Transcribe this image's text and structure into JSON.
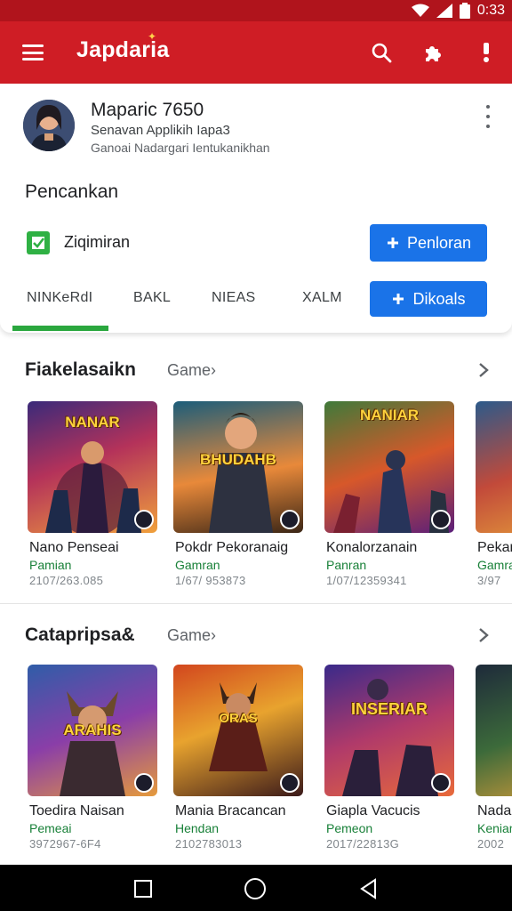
{
  "status_bar": {
    "time": "0:33",
    "icons": [
      "wifi-icon",
      "signal-icon",
      "battery-icon"
    ]
  },
  "app_bar": {
    "title": "Japdaria",
    "icons": [
      "menu-icon",
      "search-icon",
      "puzzle-icon",
      "notification-icon"
    ]
  },
  "profile": {
    "name": "Maparic 7650",
    "line1": "Senavan Applikih Iapa3",
    "line2": "Ganoai Nadargari Ientukanikhan",
    "menu_icon": "more-vert-icon"
  },
  "section": {
    "title": "Pencankan",
    "checkbox_label": "Ziqimiran",
    "primary_button": "Penloran",
    "secondary_button": "Dikoals"
  },
  "tabs": [
    "NINKeRdI",
    "BAKL",
    "NIEAS",
    "XALM"
  ],
  "rows": [
    {
      "title": "Fiakelasaikn",
      "subtitle": "Game›",
      "items": [
        {
          "name": "Nano Penseai",
          "category": "Pamian",
          "meta": "2107/263.085",
          "poster": "NANAR"
        },
        {
          "name": "Pokdr Pekoranaig",
          "category": "Gamran",
          "meta": "1/67/ 953873",
          "poster": "BHUDAHB"
        },
        {
          "name": "Konalorzanain",
          "category": "Panran",
          "meta": "1/07/12359341",
          "poster": "NANIAR"
        },
        {
          "name": "Pekar",
          "category": "Gamra",
          "meta": "3/97",
          "poster": ""
        }
      ]
    },
    {
      "title": "Catapripsa&",
      "subtitle": "Game›",
      "items": [
        {
          "name": "Toedira Naisan",
          "category": "Pemeai",
          "meta": "3972967-6F4",
          "poster": "ARAHIS"
        },
        {
          "name": "Mania Bracancan",
          "category": "Hendan",
          "meta": "2102783013",
          "poster": "ORAS"
        },
        {
          "name": "Giapla Vacucis",
          "category": "Pemeon",
          "meta": "2017/22813G",
          "poster": "INSERIAR"
        },
        {
          "name": "Nadar",
          "category": "Kenian",
          "meta": "2002",
          "poster": ""
        }
      ]
    }
  ],
  "nav": [
    "recents-square-icon",
    "home-circle-icon",
    "back-triangle-icon"
  ],
  "colors": {
    "app_bar": "#cf1d25",
    "status_bar": "#b0141c",
    "accent_blue": "#1a73e8",
    "accent_green": "#2aa73e"
  }
}
